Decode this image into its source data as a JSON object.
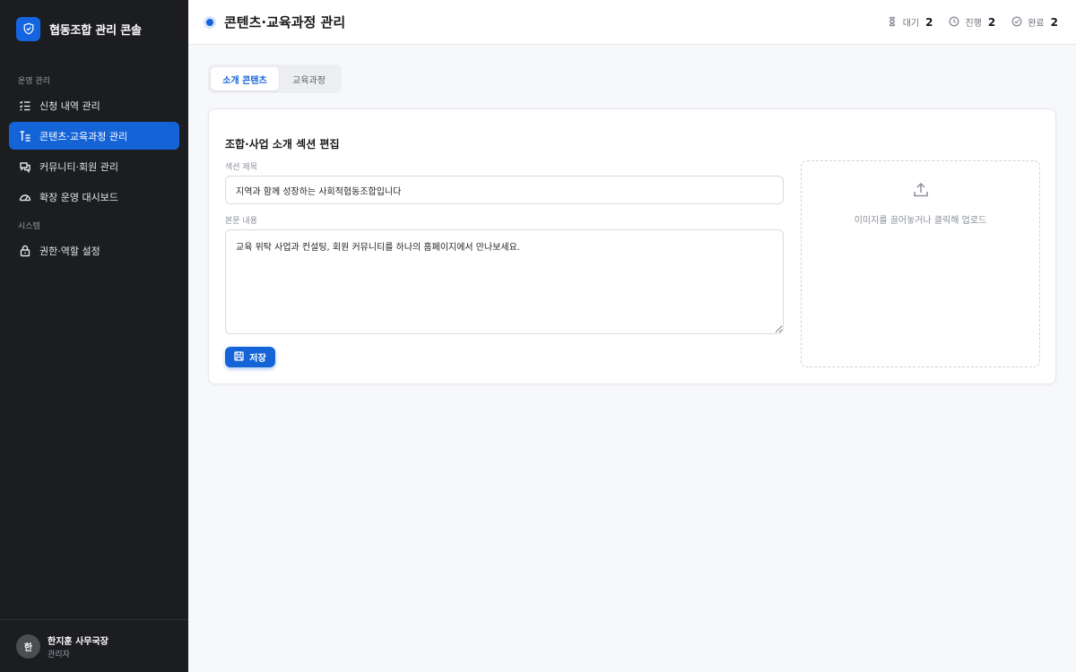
{
  "brand": {
    "title": "협동조합 관리 콘솔",
    "logo_icon": "shield-check-icon",
    "color": "#1565e0"
  },
  "sidebar": {
    "sections": [
      {
        "label": "운영 관리"
      },
      {
        "label": "시스템"
      }
    ],
    "items": [
      {
        "label": "신청 내역 관리",
        "icon": "list-icon",
        "active": false
      },
      {
        "label": "콘텐츠·교육과정 관리",
        "icon": "content-icon",
        "active": true
      },
      {
        "label": "커뮤니티·회원 관리",
        "icon": "chat-icon",
        "active": false
      },
      {
        "label": "확장 운영 대시보드",
        "icon": "gauge-icon",
        "active": false
      },
      {
        "label": "권한·역할 설정",
        "icon": "lock-icon",
        "active": false
      }
    ]
  },
  "user": {
    "avatar": "한",
    "name": "한지훈 사무국장",
    "role": "관리자"
  },
  "header": {
    "title": "콘텐츠·교육과정 관리",
    "stats": [
      {
        "label": "대기",
        "value": "2",
        "icon": "hourglass-icon"
      },
      {
        "label": "진행",
        "value": "2",
        "icon": "clock-icon"
      },
      {
        "label": "완료",
        "value": "2",
        "icon": "check-circle-icon"
      }
    ]
  },
  "tabs": [
    {
      "label": "소개 콘텐츠",
      "active": true
    },
    {
      "label": "교육과정",
      "active": false
    }
  ],
  "editor": {
    "title": "조합·사업 소개 섹션 편집",
    "section_title_label": "섹션 제목",
    "section_title_value": "지역과 함께 성장하는 사회적협동조합입니다",
    "body_label": "본문 내용",
    "body_value": "교육 위탁 사업과 컨설팅, 회원 커뮤니티를 하나의 홈페이지에서 만나보세요.",
    "save_label": "저장",
    "upload_text": "이미지를 끌어놓거나 클릭해 업로드"
  },
  "colors": {
    "accent": "#1464d8",
    "sidebar_bg": "#1c1d21",
    "page_bg": "#f7f8fa"
  }
}
